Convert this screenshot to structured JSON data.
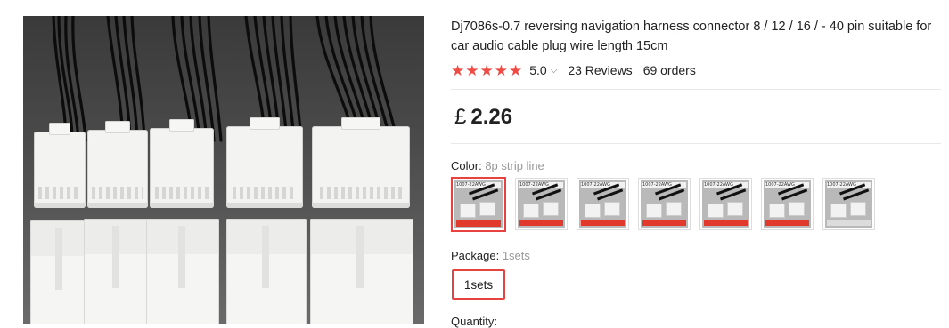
{
  "product": {
    "title": "Dj7086s-0.7 reversing navigation harness connector 8 / 12 / 16 / - 40 pin suitable for car audio cable plug wire length 15cm",
    "rating": {
      "stars": 5,
      "value": "5.0",
      "reviews": "23 Reviews",
      "orders": "69 orders"
    },
    "price": {
      "currency": "£",
      "amount": "2.26"
    }
  },
  "color": {
    "label": "Color:",
    "selected": "8p strip line",
    "swatch_header_text": "1007-22AWG",
    "swatch_count": 7,
    "selected_index": 0
  },
  "package": {
    "label": "Package:",
    "selected": "1sets",
    "options": [
      "1sets"
    ]
  },
  "quantity": {
    "label": "Quantity:"
  },
  "colors": {
    "accent": "#e64340",
    "star": "#f04a45",
    "muted": "#999999"
  },
  "icons": {
    "star": "star-icon",
    "chevron": "chevron-down-icon"
  }
}
